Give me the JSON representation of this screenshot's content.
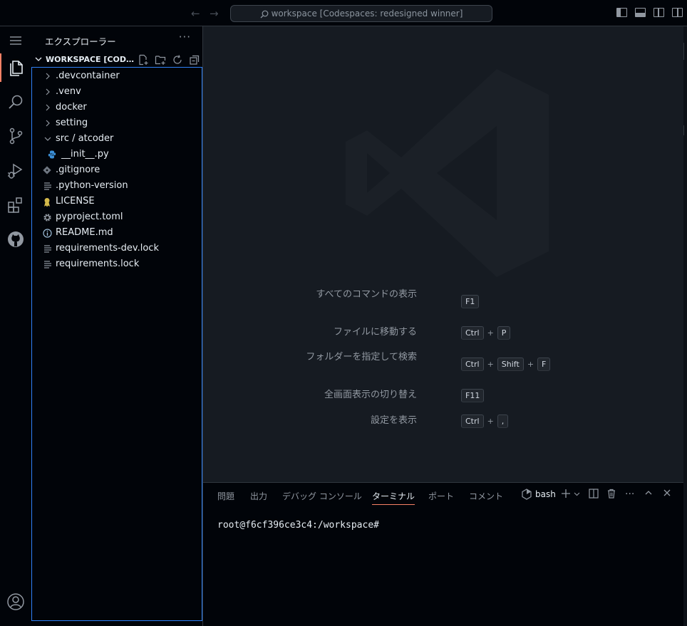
{
  "titlebar": {
    "command_center": "workspace [Codespaces: redesigned winner]",
    "back_icon": "arrow-left-icon",
    "forward_icon": "arrow-right-icon"
  },
  "activity_bar": {
    "items": [
      "menu-icon",
      "files-icon",
      "search-icon",
      "source-control-icon",
      "run-debug-icon",
      "extensions-icon",
      "github-icon"
    ],
    "bottom": [
      "account-icon"
    ]
  },
  "sidebar": {
    "title": "エクスプローラー",
    "more": "···",
    "workspace_title": "WORKSPACE [CODESPACES: REDESIGNED WINNER]",
    "tree": [
      {
        "label": ".devcontainer",
        "type": "folder"
      },
      {
        "label": ".venv",
        "type": "folder"
      },
      {
        "label": "docker",
        "type": "folder"
      },
      {
        "label": "setting",
        "type": "folder"
      },
      {
        "label": "src / atcoder",
        "type": "folder-open"
      },
      {
        "label": "__init__.py",
        "type": "python"
      },
      {
        "label": ".gitignore",
        "type": "git"
      },
      {
        "label": ".python-version",
        "type": "text"
      },
      {
        "label": "LICENSE",
        "type": "license"
      },
      {
        "label": "pyproject.toml",
        "type": "gear"
      },
      {
        "label": "README.md",
        "type": "info"
      },
      {
        "label": "requirements-dev.lock",
        "type": "text"
      },
      {
        "label": "requirements.lock",
        "type": "text"
      }
    ]
  },
  "editor": {
    "shortcuts": [
      {
        "label": "すべてのコマンドの表示",
        "keys": [
          "F1"
        ]
      },
      {
        "label": "ファイルに移動する",
        "keys": [
          "Ctrl",
          "P"
        ]
      },
      {
        "label": "フォルダーを指定して検索",
        "keys": [
          "Ctrl",
          "Shift",
          "F"
        ]
      },
      {
        "label": "全画面表示の切り替え",
        "keys": [
          "F11"
        ]
      },
      {
        "label": "設定を表示",
        "keys": [
          "Ctrl",
          ","
        ]
      }
    ]
  },
  "panel": {
    "tabs": [
      "問題",
      "出力",
      "デバッグ コンソール",
      "ターミナル",
      "ポート",
      "コメント"
    ],
    "active_tab": "ターミナル",
    "terminal_name": "bash",
    "prompt": "root@f6cf396ce3c4:/workspace#"
  },
  "colors": {
    "accent": "#f78166",
    "focus_border": "#2f81f7",
    "background": "#010409",
    "editor_background": "#161b22"
  }
}
